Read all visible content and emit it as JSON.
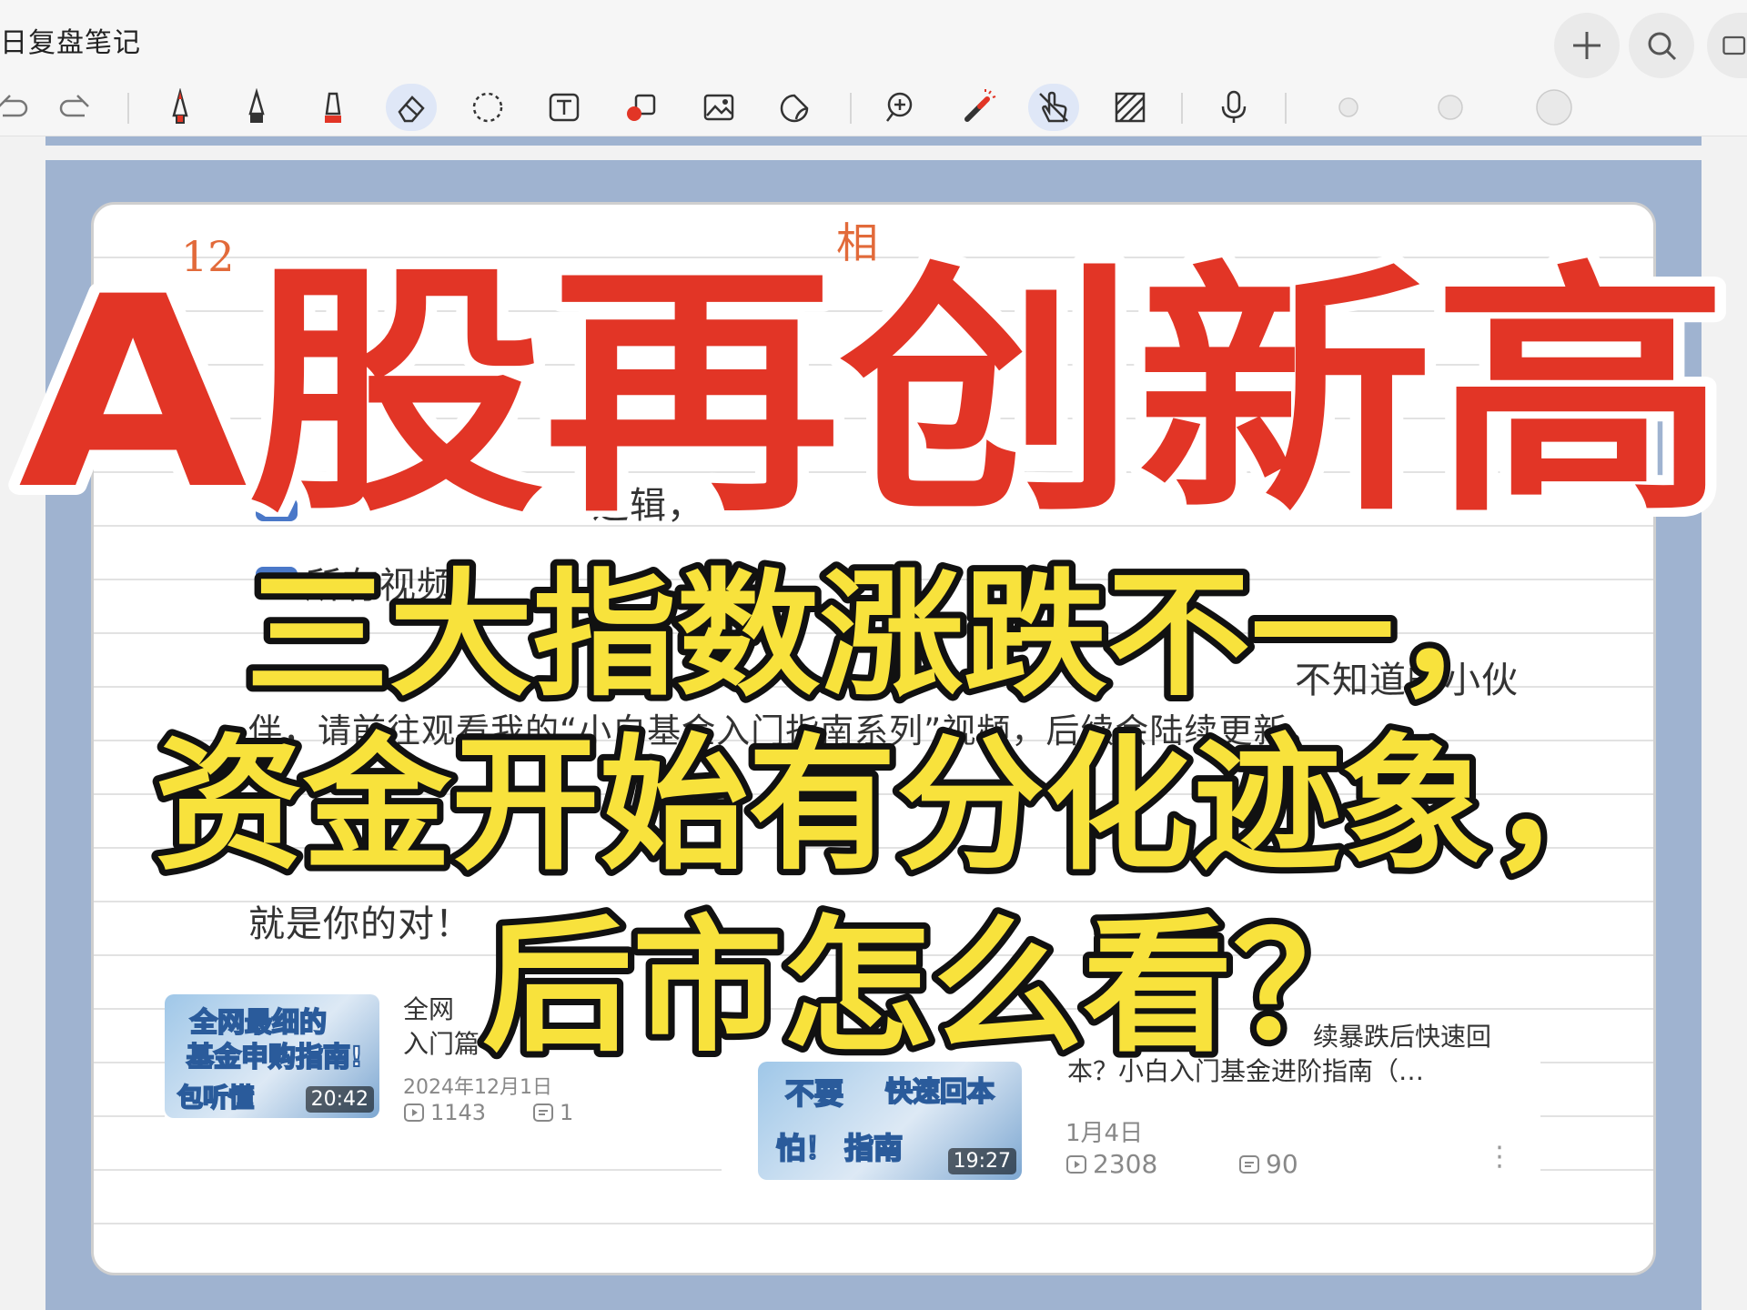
{
  "app": {
    "doc_title": "日复盘笔记"
  },
  "toolbar": {
    "tools": [
      "undo-icon",
      "redo-icon",
      "pen-icon",
      "fountain-pen-icon",
      "highlighter-icon",
      "eraser-icon",
      "lasso-icon",
      "text-box-icon",
      "shapes-icon",
      "image-icon",
      "sticker-icon",
      "zoom-in-icon",
      "laser-pointer-icon",
      "touch-writing-icon",
      "ruler-icon",
      "microphone-icon",
      "pen-size-small-icon",
      "pen-size-medium-icon",
      "pen-size-large-icon"
    ],
    "active_tools": [
      "eraser-icon",
      "touch-writing-icon"
    ]
  },
  "note": {
    "lines": [
      "逻辑，",
      "所有视频",
      "不知道的小伙",
      "伴，请前往观看我的“小白基金入门指南系列”视频，后续会陆续更新。",
      "就是你的对！"
    ],
    "hand_marks": [
      "12",
      "相"
    ]
  },
  "overlay": {
    "headline": "A股再创新高",
    "sub_lines": [
      "三大指数涨跌不一，",
      "资金开始有分化迹象，",
      "后市怎么看？"
    ],
    "headline_color": "#e23526",
    "sub_color": "#f8e23c"
  },
  "cards": [
    {
      "thumb_lines": [
        "全网最细的",
        "基金申购指南!"
      ],
      "thumb_bottom": "包听懂",
      "duration": "20:42",
      "title_lines": [
        "全网",
        "入门篇"
      ],
      "date": "2024年12月1日",
      "plays": "1143",
      "comments": "1"
    },
    {
      "thumb_lines": [
        "不要",
        "快速回本"
      ],
      "thumb_bottom": "怕！ 指南",
      "duration": "19:27",
      "title_lines": [
        "续暴跌后快速回",
        "本？小白入门基金进阶指南（…"
      ],
      "date": "1月4日",
      "plays": "2308",
      "comments": "90"
    }
  ]
}
